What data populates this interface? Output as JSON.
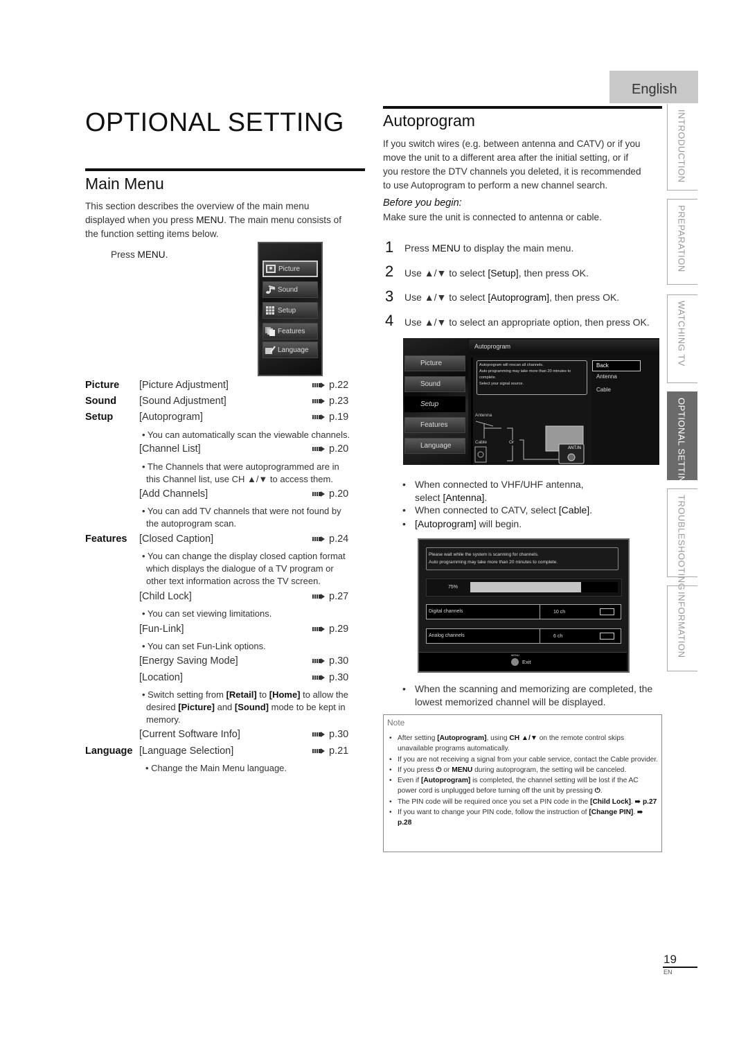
{
  "language_tab": "English",
  "page_title": "OPTIONAL SETTING",
  "side_tabs": [
    {
      "label": "INTRODUCTION",
      "active": false
    },
    {
      "label": "PREPARATION",
      "active": false
    },
    {
      "label": "WATCHING TV",
      "active": false
    },
    {
      "label": "OPTIONAL SETTING",
      "active": true
    },
    {
      "label": "TROUBLESHOOTING",
      "active": false
    },
    {
      "label": "INFORMATION",
      "active": false
    }
  ],
  "main_menu": {
    "heading": "Main Menu",
    "intro_1": "This section describes the overview of the main menu",
    "intro_2a": "displayed when you press ",
    "intro_2b": "MENU",
    "intro_2c": ". The main menu consists of",
    "intro_3": "the function setting items below.",
    "press_a": "Press ",
    "press_b": "MENU",
    "press_c": ".",
    "tv_menu_items": [
      {
        "label": "Picture",
        "icon": "picture-icon",
        "selected": true
      },
      {
        "label": "Sound",
        "icon": "music-note-icon",
        "selected": false
      },
      {
        "label": "Setup",
        "icon": "grid-icon",
        "selected": false
      },
      {
        "label": "Features",
        "icon": "pages-icon",
        "selected": false
      },
      {
        "label": "Language",
        "icon": "keyboard-pen-icon",
        "selected": false
      }
    ],
    "rows": [
      {
        "category": "Picture",
        "item": "[Picture Adjustment]",
        "ref": "p.22"
      },
      {
        "category": "Sound",
        "item": "[Sound Adjustment]",
        "ref": "p.23"
      },
      {
        "category": "Setup",
        "item": "[Autoprogram]",
        "ref": "p.19"
      },
      {
        "category": "",
        "item": "[Channel List]",
        "ref": "p.20"
      },
      {
        "category": "",
        "item": "[Add Channels]",
        "ref": "p.20"
      },
      {
        "category": "Features",
        "item": "[Closed Caption]",
        "ref": "p.24"
      },
      {
        "category": "",
        "item": "[Child Lock]",
        "ref": "p.27"
      },
      {
        "category": "",
        "item": "[Fun-Link]",
        "ref": "p.29"
      },
      {
        "category": "",
        "item": "[Energy Saving Mode]",
        "ref": "p.30"
      },
      {
        "category": "",
        "item": "[Location]",
        "ref": "p.30"
      },
      {
        "category": "",
        "item": "[Current Software Info]",
        "ref": "p.30"
      },
      {
        "category": "Language",
        "item": "[Language Selection]",
        "ref": "p.21"
      }
    ],
    "notes": {
      "autoprogram": "• You can automatically scan the viewable channels.",
      "channel_list_1": "• The Channels that were autoprogrammed are in",
      "channel_list_2": "this Channel list, use CH ▲/▼ to access them.",
      "add_channels_1": "• You can add TV channels that were not found by",
      "add_channels_2": "the autoprogram scan.",
      "closed_caption_1": "• You can change the display closed caption format",
      "closed_caption_2": "which displays the dialogue of a TV program or",
      "closed_caption_3": "other text information across the TV screen.",
      "child_lock": "• You can set viewing limitations.",
      "fun_link": "• You can set Fun-Link options.",
      "location_1a": "• Switch setting from ",
      "location_1b": "[Retail]",
      "location_1c": " to ",
      "location_1d": "[Home]",
      "location_1e": " to allow the",
      "location_2a": "desired ",
      "location_2b": "[Picture]",
      "location_2c": " and ",
      "location_2d": "[Sound]",
      "location_2e": " mode to be kept in",
      "location_3": "memory.",
      "language": "• Change the Main Menu language."
    }
  },
  "autoprogram": {
    "heading": "Autoprogram",
    "intro": [
      "If you switch wires (e.g. between antenna and CATV) or if you",
      "move the unit to a different area after the initial setting, or if",
      "you restore the DTV channels you deleted, it is recommended",
      "to use Autoprogram to perform a new channel search."
    ],
    "before_label": "Before you begin:",
    "before_text": "Make sure the unit is connected to antenna or cable.",
    "steps": [
      {
        "num": "1",
        "a": "Press ",
        "b": "MENU",
        "c": " to display the main menu."
      },
      {
        "num": "2",
        "a": "Use ▲/▼ to select ",
        "b": "[Setup]",
        "c": ", then press OK."
      },
      {
        "num": "3",
        "a": "Use ▲/▼ to select ",
        "b": "[Autoprogram]",
        "c": ", then press OK."
      },
      {
        "num": "4",
        "a": "Use ▲/▼ to select an appropriate option, then press OK.",
        "b": "",
        "c": ""
      }
    ],
    "screen1": {
      "title": "Autoprogram",
      "menu": [
        "Picture",
        "Sound",
        "Setup",
        "Features",
        "Language"
      ],
      "message": [
        "Autoprogram will rescan all channels.",
        "Auto programming may take more than 20 minutes to",
        "complete.",
        "Select your signal source."
      ],
      "options": [
        "Back",
        "Antenna",
        "Cable"
      ],
      "diagram_antenna": "Antenna",
      "diagram_cable": "Cable",
      "diagram_or": "Or",
      "diagram_port": "ANT.IN"
    },
    "bullets1": {
      "b1a": "When connected to VHF/UHF antenna,",
      "b1b": "select ",
      "b1c": "[Antenna]",
      "b1d": ".",
      "b2a": "When connected to CATV, select ",
      "b2b": "[Cable]",
      "b2c": ".",
      "b3a": "[Autoprogram]",
      "b3b": " will begin."
    },
    "screen2": {
      "message_1": "Please wait while the system is scanning for channels.",
      "message_2": "Auto programming may take more than 20 minutes to complete.",
      "progress_label": "75%",
      "progress_value": 0.75,
      "digital_label": "Digital channels",
      "digital_value": "10 ch",
      "analog_label": "Analog channels",
      "analog_value": "6 ch",
      "menu_key": "MENU",
      "exit_label": "Exit"
    },
    "bullet_done_1": "When the scanning and memorizing are completed, the",
    "bullet_done_2": "lowest memorized channel will be displayed."
  },
  "note": {
    "title": "Note",
    "items": [
      {
        "parts": [
          "After setting ",
          "[Autoprogram]",
          ", using ",
          "CH ▲/▼",
          " on the remote control skips unavailable programs automatically."
        ]
      },
      {
        "parts": [
          "If you are not receiving a signal from your cable service, contact the Cable provider."
        ]
      },
      {
        "parts": [
          "If you press ",
          "⏻",
          " or ",
          "MENU",
          " during autoprogram, the setting will be canceled."
        ]
      },
      {
        "parts": [
          "Even if ",
          "[Autoprogram]",
          " is completed, the channel setting will be lost if the AC power cord is unplugged before turning off the unit by pressing ",
          "⏻",
          "."
        ]
      },
      {
        "parts": [
          "The PIN code will be required once you set a PIN code in the ",
          "[Child Lock]",
          ". ",
          "➠ p.27",
          ""
        ]
      },
      {
        "parts": [
          "If you want to change your PIN code, follow the instruction of ",
          "[Change PIN]",
          ". ",
          "➠ p.28",
          ""
        ]
      }
    ]
  },
  "footer": {
    "page_number": "19",
    "lang_code": "EN"
  }
}
